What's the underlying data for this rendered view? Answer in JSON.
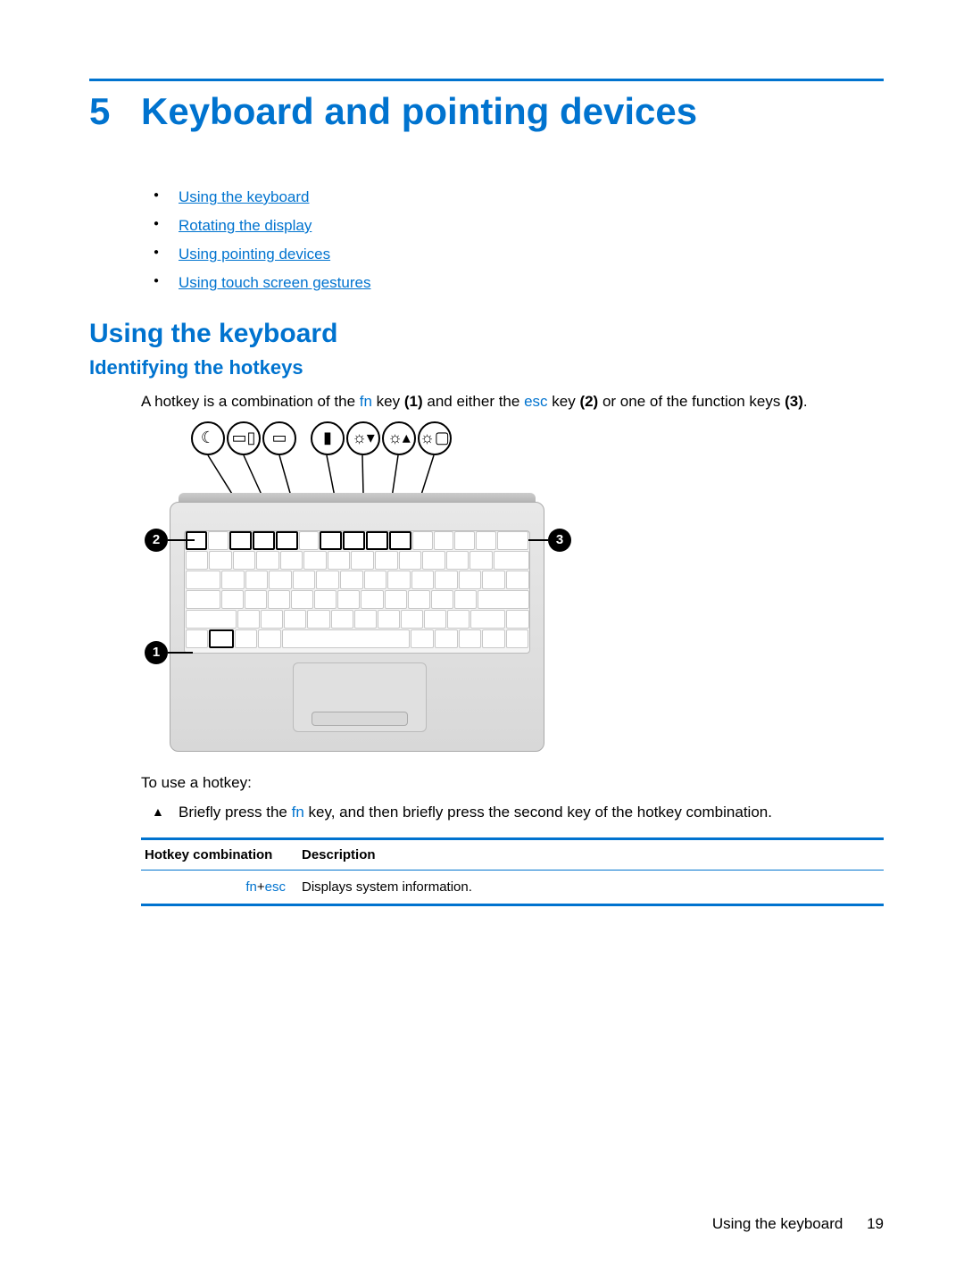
{
  "chapter": {
    "number": "5",
    "title": "Keyboard and pointing devices"
  },
  "toc": [
    "Using the keyboard",
    "Rotating the display",
    "Using pointing devices",
    "Using touch screen gestures"
  ],
  "section_h2": "Using the keyboard",
  "section_h3": "Identifying the hotkeys",
  "intro": {
    "pre": "A hotkey is a combination of the ",
    "fn": "fn",
    "mid1": " key ",
    "b1": "(1)",
    "mid2": " and either the ",
    "esc": "esc",
    "mid3": " key ",
    "b2": "(2)",
    "mid4": " or one of the function keys ",
    "b3": "(3)",
    "end": "."
  },
  "callouts": {
    "c1": "1",
    "c2": "2",
    "c3": "3"
  },
  "use_hotkey_label": "To use a hotkey:",
  "instruction": {
    "pre": "Briefly press the ",
    "fn": "fn",
    "post": " key, and then briefly press the second key of the hotkey combination."
  },
  "table": {
    "headers": {
      "combo": "Hotkey combination",
      "desc": "Description"
    },
    "rows": [
      {
        "combo_fn": "fn",
        "combo_plus": "+",
        "combo_key": "esc",
        "desc": "Displays system information."
      }
    ]
  },
  "footer": {
    "section": "Using the keyboard",
    "page": "19"
  },
  "icons": [
    "moon",
    "dual-screen",
    "screen",
    "battery",
    "bright-down",
    "bright-up",
    "bright-auto"
  ]
}
